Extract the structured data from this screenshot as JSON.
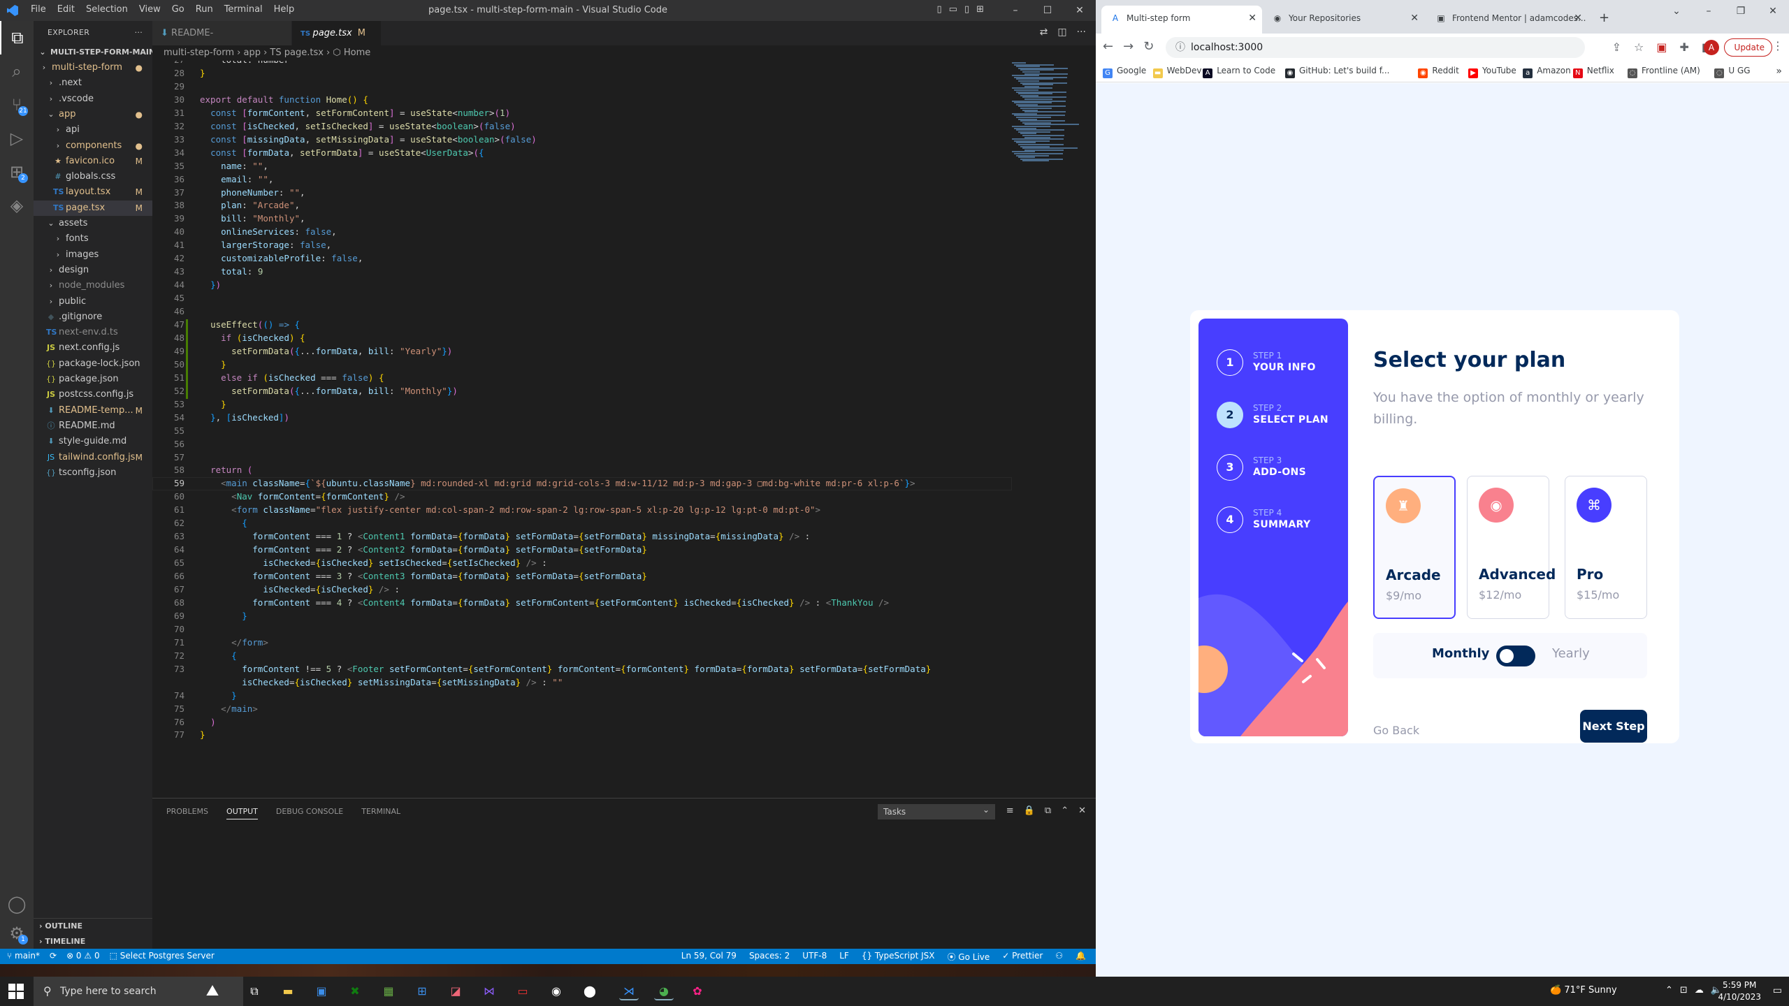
{
  "vscode": {
    "window_title": "page.tsx - multi-step-form-main - Visual Studio Code",
    "menu": [
      "File",
      "Edit",
      "Selection",
      "View",
      "Go",
      "Run",
      "Terminal",
      "Help"
    ],
    "activity": [
      {
        "name": "explorer",
        "glyph": "⧉"
      },
      {
        "name": "search",
        "glyph": "⌕"
      },
      {
        "name": "source-control",
        "glyph": "⑂",
        "badge": "21"
      },
      {
        "name": "run-debug",
        "glyph": "▷"
      },
      {
        "name": "extensions",
        "glyph": "⊞",
        "badge": "2"
      },
      {
        "name": "remote",
        "glyph": "◈"
      }
    ],
    "explorer_title": "EXPLORER",
    "explorer_more": "···",
    "root": "MULTI-STEP-FORM-MAIN",
    "tree": [
      {
        "indent": 0,
        "icon": "›",
        "label": "multi-step-form",
        "status": "●",
        "cls": "mod",
        "open": true
      },
      {
        "indent": 1,
        "icon": "›",
        "label": ".next",
        "status": "",
        "cls": ""
      },
      {
        "indent": 1,
        "icon": "›",
        "label": ".vscode",
        "status": "",
        "cls": ""
      },
      {
        "indent": 1,
        "icon": "⌄",
        "label": "app",
        "status": "●",
        "cls": "mod"
      },
      {
        "indent": 2,
        "icon": "›",
        "label": "api",
        "status": "",
        "cls": ""
      },
      {
        "indent": 2,
        "icon": "›",
        "label": "components",
        "status": "●",
        "cls": "mod"
      },
      {
        "indent": 2,
        "icon": "★",
        "label": "favicon.ico",
        "status": "M",
        "cls": "mod",
        "icls": "ic-fav"
      },
      {
        "indent": 2,
        "icon": "#",
        "label": "globals.css",
        "status": "",
        "cls": "",
        "icls": "ic-css"
      },
      {
        "indent": 2,
        "icon": "TS",
        "label": "layout.tsx",
        "status": "M",
        "cls": "mod",
        "icls": "ic-ts"
      },
      {
        "indent": 2,
        "icon": "TS",
        "label": "page.tsx",
        "status": "M",
        "cls": "mod",
        "icls": "ic-ts",
        "sel": true
      },
      {
        "indent": 1,
        "icon": "⌄",
        "label": "assets",
        "status": "",
        "cls": ""
      },
      {
        "indent": 2,
        "icon": "›",
        "label": "fonts",
        "status": "",
        "cls": ""
      },
      {
        "indent": 2,
        "icon": "›",
        "label": "images",
        "status": "",
        "cls": ""
      },
      {
        "indent": 1,
        "icon": "›",
        "label": "design",
        "status": "",
        "cls": ""
      },
      {
        "indent": 1,
        "icon": "›",
        "label": "node_modules",
        "status": "",
        "cls": "dim"
      },
      {
        "indent": 1,
        "icon": "›",
        "label": "public",
        "status": "",
        "cls": ""
      },
      {
        "indent": 1,
        "icon": "◆",
        "label": ".gitignore",
        "status": "",
        "cls": "",
        "icls": "ic-git"
      },
      {
        "indent": 1,
        "icon": "TS",
        "label": "next-env.d.ts",
        "status": "",
        "cls": "dim",
        "icls": "ic-ts"
      },
      {
        "indent": 1,
        "icon": "JS",
        "label": "next.config.js",
        "status": "",
        "cls": "",
        "icls": "ic-js"
      },
      {
        "indent": 1,
        "icon": "{}",
        "label": "package-lock.json",
        "status": "",
        "cls": "",
        "icls": "ic-json"
      },
      {
        "indent": 1,
        "icon": "{}",
        "label": "package.json",
        "status": "",
        "cls": "",
        "icls": "ic-json"
      },
      {
        "indent": 1,
        "icon": "JS",
        "label": "postcss.config.js",
        "status": "",
        "cls": "",
        "icls": "ic-js"
      },
      {
        "indent": 1,
        "icon": "⬇",
        "label": "README-temp...",
        "status": "M",
        "cls": "mod",
        "icls": "ic-md"
      },
      {
        "indent": 1,
        "icon": "ⓘ",
        "label": "README.md",
        "status": "",
        "cls": "",
        "icls": "ic-info"
      },
      {
        "indent": 1,
        "icon": "⬇",
        "label": "style-guide.md",
        "status": "",
        "cls": "",
        "icls": "ic-md"
      },
      {
        "indent": 1,
        "icon": "JS",
        "label": "tailwind.config.js",
        "status": "M",
        "cls": "mod",
        "icls": "ic-tw"
      },
      {
        "indent": 1,
        "icon": "{}",
        "label": "tsconfig.json",
        "status": "",
        "cls": "",
        "icls": "ic-info"
      }
    ],
    "outline": "OUTLINE",
    "timeline": "TIMELINE",
    "tabs": [
      {
        "label": "README-template.md",
        "mod": "M",
        "active": false
      },
      {
        "label": "page.tsx",
        "mod": "M",
        "active": true
      }
    ],
    "breadcrumb": "multi-step-form  ›  app  ›  TS page.tsx  ›  ⬡ Home",
    "code_lines": [
      {
        "n": "27",
        "h": "    total: number"
      },
      {
        "n": "28",
        "h": "<span class=brk>}</span>"
      },
      {
        "n": "29",
        "h": ""
      },
      {
        "n": "30",
        "h": "<span class=ctl>export</span> <span class=ctl>default</span> <span class=kw>function</span> <span class=fn>Home</span><span class=brk>()</span> <span class=brk>{</span>"
      },
      {
        "n": "31",
        "h": "  <span class=kw>const</span> <span class=brk2>[</span><span class=var>formContent</span>, <span class=fn>setFormContent</span><span class=brk2>]</span> = <span class=fn>useState</span>&lt;<span class=typ>number</span>&gt;<span class=brk2>(</span><span class=num>1</span><span class=brk2>)</span>"
      },
      {
        "n": "32",
        "h": "  <span class=kw>const</span> <span class=brk2>[</span><span class=var>isChecked</span>, <span class=fn>setIsChecked</span><span class=brk2>]</span> = <span class=fn>useState</span>&lt;<span class=typ>boolean</span>&gt;<span class=brk2>(</span><span class=kw>false</span><span class=brk2>)</span>"
      },
      {
        "n": "33",
        "h": "  <span class=kw>const</span> <span class=brk2>[</span><span class=var>missingData</span>, <span class=fn>setMissingData</span><span class=brk2>]</span> = <span class=fn>useState</span>&lt;<span class=typ>boolean</span>&gt;<span class=brk2>(</span><span class=kw>false</span><span class=brk2>)</span>"
      },
      {
        "n": "34",
        "h": "  <span class=kw>const</span> <span class=brk2>[</span><span class=var>formData</span>, <span class=fn>setFormData</span><span class=brk2>]</span> = <span class=fn>useState</span>&lt;<span class=typ>UserData</span>&gt;<span class=brk2>(</span><span class=brk3>{</span>"
      },
      {
        "n": "35",
        "h": "    <span class=var>name</span>: <span class=str>\"\"</span>,"
      },
      {
        "n": "36",
        "h": "    <span class=var>email</span>: <span class=str>\"\"</span>,"
      },
      {
        "n": "37",
        "h": "    <span class=var>phoneNumber</span>: <span class=str>\"\"</span>,"
      },
      {
        "n": "38",
        "h": "    <span class=var>plan</span>: <span class=str>\"Arcade\"</span>,"
      },
      {
        "n": "39",
        "h": "    <span class=var>bill</span>: <span class=str>\"Monthly\"</span>,"
      },
      {
        "n": "40",
        "h": "    <span class=var>onlineServices</span>: <span class=kw>false</span>,"
      },
      {
        "n": "41",
        "h": "    <span class=var>largerStorage</span>: <span class=kw>false</span>,"
      },
      {
        "n": "42",
        "h": "    <span class=var>customizableProfile</span>: <span class=kw>false</span>,"
      },
      {
        "n": "43",
        "h": "    <span class=var>total</span>: <span class=num>9</span>"
      },
      {
        "n": "44",
        "h": "  <span class=brk3>}</span><span class=brk2>)</span>"
      },
      {
        "n": "45",
        "h": ""
      },
      {
        "n": "46",
        "h": ""
      },
      {
        "n": "47",
        "h": "  <span class=fn>useEffect</span><span class=brk2>(</span><span class=brk3>()</span> <span class=kw>=&gt;</span> <span class=brk3>{</span>"
      },
      {
        "n": "48",
        "h": "    <span class=ctl>if</span> <span class=brk>(</span><span class=var>isChecked</span><span class=brk>)</span> <span class=brk>{</span>"
      },
      {
        "n": "49",
        "h": "      <span class=fn>setFormData</span><span class=brk2>(</span><span class=brk3>{</span>...<span class=var>formData</span>, <span class=var>bill</span>: <span class=str>\"Yearly\"</span><span class=brk3>}</span><span class=brk2>)</span>"
      },
      {
        "n": "50",
        "h": "    <span class=brk>}</span>"
      },
      {
        "n": "51",
        "h": "    <span class=ctl>else</span> <span class=ctl>if</span> <span class=brk>(</span><span class=var>isChecked</span> === <span class=kw>false</span><span class=brk>)</span> <span class=brk>{</span>"
      },
      {
        "n": "52",
        "h": "      <span class=fn>setFormData</span><span class=brk2>(</span><span class=brk3>{</span>...<span class=var>formData</span>, <span class=var>bill</span>: <span class=str>\"Monthly\"</span><span class=brk3>}</span><span class=brk2>)</span>"
      },
      {
        "n": "53",
        "h": "    <span class=brk>}</span>"
      },
      {
        "n": "54",
        "h": "  <span class=brk3>}</span>, <span class=brk3>[</span><span class=var>isChecked</span><span class=brk3>]</span><span class=brk2>)</span>"
      },
      {
        "n": "55",
        "h": ""
      },
      {
        "n": "56",
        "h": ""
      },
      {
        "n": "57",
        "h": ""
      },
      {
        "n": "58",
        "h": "  <span class=ctl>return</span> <span class=brk2>(</span>"
      },
      {
        "n": "59",
        "h": "    <span class=tag>&lt;</span><span class=kw>main</span> <span class=var>className</span>=<span class=brk3>{</span><span class=str>`${</span><span class=var>ubuntu</span>.<span class=var>className</span><span class=str>} md:rounded-xl md:grid md:grid-cols-3 md:w-11/12 md:p-3 md:gap-3 ▢md:bg-white md:pr-6 xl:p-6`</span><span class=brk3>}</span><span class=tag>&gt;</span>"
      },
      {
        "n": "60",
        "h": "      <span class=tag>&lt;</span><span class=jsx>Nav</span> <span class=var>formContent</span>=<span class=brk>{</span><span class=var>formContent</span><span class=brk>}</span> <span class=tag>/&gt;</span>"
      },
      {
        "n": "61",
        "h": "      <span class=tag>&lt;</span><span class=kw>form</span> <span class=var>className</span>=<span class=str>\"flex justify-center md:col-span-2 md:row-span-2 lg:row-span-5 xl:p-20 lg:p-12 lg:pt-0 md:pt-0\"</span><span class=tag>&gt;</span>"
      },
      {
        "n": "62",
        "h": "        <span class=brk3>{</span>"
      },
      {
        "n": "63",
        "h": "          <span class=var>formContent</span> === <span class=num>1</span> ? <span class=tag>&lt;</span><span class=jsx>Content1</span> <span class=var>formData</span>=<span class=brk>{</span><span class=var>formData</span><span class=brk>}</span> <span class=var>setFormData</span>=<span class=brk>{</span><span class=var>setFormData</span><span class=brk>}</span> <span class=var>missingData</span>=<span class=brk>{</span><span class=var>missingData</span><span class=brk>}</span> <span class=tag>/&gt;</span> :"
      },
      {
        "n": "64",
        "h": "          <span class=var>formContent</span> === <span class=num>2</span> ? <span class=tag>&lt;</span><span class=jsx>Content2</span> <span class=var>formData</span>=<span class=brk>{</span><span class=var>formData</span><span class=brk>}</span> <span class=var>setFormData</span>=<span class=brk>{</span><span class=var>setFormData</span><span class=brk>}</span>"
      },
      {
        "n": "65",
        "h": "            <span class=var>isChecked</span>=<span class=brk>{</span><span class=var>isChecked</span><span class=brk>}</span> <span class=var>setIsChecked</span>=<span class=brk>{</span><span class=var>setIsChecked</span><span class=brk>}</span> <span class=tag>/&gt;</span> :"
      },
      {
        "n": "66",
        "h": "          <span class=var>formContent</span> === <span class=num>3</span> ? <span class=tag>&lt;</span><span class=jsx>Content3</span> <span class=var>formData</span>=<span class=brk>{</span><span class=var>formData</span><span class=brk>}</span> <span class=var>setFormData</span>=<span class=brk>{</span><span class=var>setFormData</span><span class=brk>}</span>"
      },
      {
        "n": "67",
        "h": "            <span class=var>isChecked</span>=<span class=brk>{</span><span class=var>isChecked</span><span class=brk>}</span> <span class=tag>/&gt;</span> :"
      },
      {
        "n": "68",
        "h": "          <span class=var>formContent</span> === <span class=num>4</span> ? <span class=tag>&lt;</span><span class=jsx>Content4</span> <span class=var>formData</span>=<span class=brk>{</span><span class=var>formData</span><span class=brk>}</span> <span class=var>setFormContent</span>=<span class=brk>{</span><span class=var>setFormContent</span><span class=brk>}</span> <span class=var>isChecked</span>=<span class=brk>{</span><span class=var>isChecked</span><span class=brk>}</span> <span class=tag>/&gt;</span> : <span class=tag>&lt;</span><span class=jsx>ThankYou</span> <span class=tag>/&gt;</span>"
      },
      {
        "n": "69",
        "h": "        <span class=brk3>}</span>"
      },
      {
        "n": "70",
        "h": ""
      },
      {
        "n": "71",
        "h": "      <span class=tag>&lt;/</span><span class=kw>form</span><span class=tag>&gt;</span>"
      },
      {
        "n": "72",
        "h": "      <span class=brk3>{</span>"
      },
      {
        "n": "73",
        "h": "        <span class=var>formContent</span> !== <span class=num>5</span> ? <span class=tag>&lt;</span><span class=jsx>Footer</span> <span class=var>setFormContent</span>=<span class=brk>{</span><span class=var>setFormContent</span><span class=brk>}</span> <span class=var>formContent</span>=<span class=brk>{</span><span class=var>formContent</span><span class=brk>}</span> <span class=var>formData</span>=<span class=brk>{</span><span class=var>formData</span><span class=brk>}</span> <span class=var>setFormData</span>=<span class=brk>{</span><span class=var>setFormData</span><span class=brk>}</span>"
      },
      {
        "n": "",
        "h": "        <span class=var>isChecked</span>=<span class=brk>{</span><span class=var>isChecked</span><span class=brk>}</span> <span class=var>setMissingData</span>=<span class=brk>{</span><span class=var>setMissingData</span><span class=brk>}</span> <span class=tag>/&gt;</span> : <span class=str>\"\"</span>"
      },
      {
        "n": "74",
        "h": "      <span class=brk3>}</span>"
      },
      {
        "n": "75",
        "h": "    <span class=tag>&lt;/</span><span class=kw>main</span><span class=tag>&gt;</span>"
      },
      {
        "n": "76",
        "h": "  <span class=brk2>)</span>"
      },
      {
        "n": "77",
        "h": "<span class=brk>}</span>"
      }
    ],
    "current_line": "59",
    "panel_tabs": [
      "PROBLEMS",
      "OUTPUT",
      "DEBUG CONSOLE",
      "TERMINAL"
    ],
    "panel_active": "OUTPUT",
    "panel_dropdown": "Tasks",
    "status_left": [
      "⑂ main*",
      "⟳",
      "⊗ 0 ⚠ 0",
      "⬚ Select Postgres Server"
    ],
    "status_right": [
      "Ln 59, Col 79",
      "Spaces: 2",
      "UTF-8",
      "LF",
      "{} TypeScript JSX",
      "⦿ Go Live",
      "✓ Prettier",
      "⚇",
      "🔔"
    ]
  },
  "chrome": {
    "tabs": [
      {
        "label": "Multi-step form",
        "icon": "A",
        "active": true
      },
      {
        "label": "Your Repositories",
        "icon": "◉",
        "active": false
      },
      {
        "label": "Frontend Mentor | adamcodes...",
        "icon": "▣",
        "active": false
      }
    ],
    "new_tab": "+",
    "url": "localhost:3000",
    "profile_initial": "A",
    "update_label": "Update",
    "bookmarks": [
      {
        "label": "Google",
        "icon": "G",
        "color": "#4285f4"
      },
      {
        "label": "WebDev",
        "icon": "▬",
        "color": "#f2c94c"
      },
      {
        "label": "Learn to Code",
        "icon": "A",
        "color": "#0a0a23"
      },
      {
        "label": "GitHub: Let's build f...",
        "icon": "◉",
        "color": "#24292f"
      },
      {
        "label": "Reddit",
        "icon": "◉",
        "color": "#ff4500"
      },
      {
        "label": "YouTube",
        "icon": "▶",
        "color": "#ff0000"
      },
      {
        "label": "Amazon",
        "icon": "a",
        "color": "#232f3e"
      },
      {
        "label": "Netflix",
        "icon": "N",
        "color": "#e50914"
      },
      {
        "label": "Frontline (AM)",
        "icon": "◌",
        "color": "#555555"
      },
      {
        "label": "U GG",
        "icon": "◌",
        "color": "#555555"
      }
    ]
  },
  "app": {
    "steps": [
      {
        "num": "1",
        "label": "STEP 1",
        "name": "YOUR INFO",
        "active": false
      },
      {
        "num": "2",
        "label": "STEP 2",
        "name": "SELECT PLAN",
        "active": true
      },
      {
        "num": "3",
        "label": "STEP 3",
        "name": "ADD-ONS",
        "active": false
      },
      {
        "num": "4",
        "label": "STEP 4",
        "name": "SUMMARY",
        "active": false
      }
    ],
    "title": "Select your plan",
    "subtitle": "You have the option of monthly or yearly billing.",
    "plans": [
      {
        "name": "Arcade",
        "price": "$9/mo",
        "color": "#ffaf7e",
        "icon": "♜",
        "selected": true
      },
      {
        "name": "Advanced",
        "price": "$12/mo",
        "color": "#f9818e",
        "icon": "◉",
        "selected": false
      },
      {
        "name": "Pro",
        "price": "$15/mo",
        "color": "#483eff",
        "icon": "⌘",
        "selected": false
      }
    ],
    "billing_monthly": "Monthly",
    "billing_yearly": "Yearly",
    "back_label": "Go Back",
    "next_label": "Next Step",
    "colors": {
      "sidebar": "#483eff",
      "marine": "#02295a",
      "accent": "#473dff"
    }
  },
  "taskbar": {
    "search_placeholder": "Type here to search",
    "weather": "71°F  Sunny",
    "time": "5:59 PM",
    "date": "4/10/2023"
  }
}
